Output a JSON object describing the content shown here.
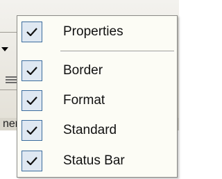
{
  "background": {
    "partial_text": "ner"
  },
  "menu": {
    "items": [
      {
        "label": "Properties",
        "checked": true
      },
      {
        "label": "Border",
        "checked": true
      },
      {
        "label": "Format",
        "checked": true
      },
      {
        "label": "Standard",
        "checked": true
      },
      {
        "label": "Status Bar",
        "checked": true
      }
    ]
  },
  "colors": {
    "menu_bg": "#fcfcf5",
    "check_box_border": "#3c6c9d",
    "check_box_fill": "#dfe8f2"
  }
}
